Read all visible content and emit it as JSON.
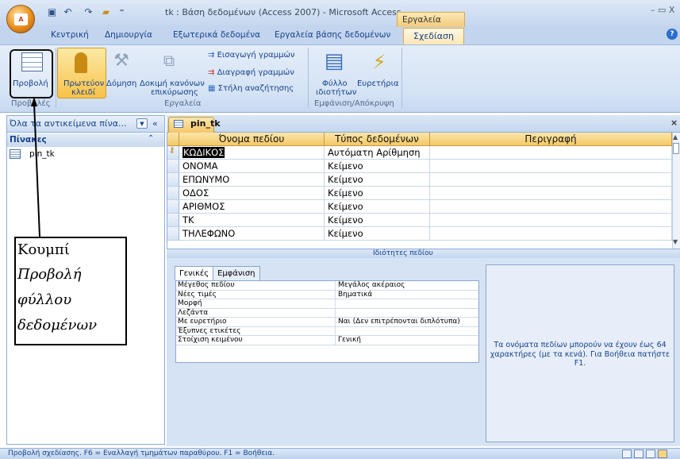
{
  "window": {
    "title": "tk : Βάση δεδομένων (Access 2007) - Microsoft Access",
    "contextual_tab_group": "Εργαλεία πίνακα",
    "controls": "– ▭ X"
  },
  "qat": {
    "save_icon": "save-icon",
    "undo_icon": "undo-icon",
    "redo_icon": "redo-icon",
    "open_icon": "folder-icon"
  },
  "office_button": {
    "icon": "office-logo-icon"
  },
  "menu_tabs": [
    "Κεντρική",
    "Δημιουργία",
    "Εξωτερικά δεδομένα",
    "Εργαλεία βάσης δεδομένων",
    "Σχεδίαση"
  ],
  "ribbon": {
    "groups": {
      "views": "Προβολές",
      "tools": "Εργαλεία",
      "show_hide": "Εμφάνιση/Απόκρυψη"
    },
    "buttons": {
      "view": "Προβολή",
      "primary_key_1": "Πρωτεύον",
      "primary_key_2": "κλειδί",
      "builder": "Δόμηση",
      "test_rules_1": "Δοκιμή κανόνων",
      "test_rules_2": "επικύρωσης",
      "insert_rows": "Εισαγωγή γραμμών",
      "delete_rows": "Διαγραφή γραμμών",
      "lookup_column": "Στήλη αναζήτησης",
      "property_sheet_1": "Φύλλο",
      "property_sheet_2": "ιδιοτήτων",
      "indexes": "Ευρετήρια"
    }
  },
  "nav_pane": {
    "title": "Όλα τα αντικείμενα πίνα...",
    "collapse": "«",
    "group": "Πίνακες",
    "group_chevron": "⌃",
    "items": [
      "pin_tk"
    ]
  },
  "document": {
    "tab": "pin_tk",
    "close": "×",
    "columns": [
      "Όνομα πεδίου",
      "Τύπος δεδομένων",
      "Περιγραφή"
    ],
    "rows": [
      {
        "name": "ΚΩΔΙΚΟΣ",
        "type": "Αυτόματη Αρίθμηση",
        "desc": ""
      },
      {
        "name": "ΟΝΟΜΑ",
        "type": "Κείμενο",
        "desc": ""
      },
      {
        "name": "ΕΠΩΝΥΜΟ",
        "type": "Κείμενο",
        "desc": ""
      },
      {
        "name": "ΟΔΟΣ",
        "type": "Κείμενο",
        "desc": ""
      },
      {
        "name": "ΑΡΙΘΜΟΣ",
        "type": "Κείμενο",
        "desc": ""
      },
      {
        "name": "ΤΚ",
        "type": "Κείμενο",
        "desc": ""
      },
      {
        "name": "ΤΗΛΕΦΩΝΟ",
        "type": "Κείμενο",
        "desc": ""
      }
    ]
  },
  "properties": {
    "title": "Ιδιότητες πεδίου",
    "tabs": [
      "Γενικές",
      "Εμφάνιση"
    ],
    "rows": [
      {
        "label": "Μέγεθος πεδίου",
        "value": "Μεγάλος ακέραιος"
      },
      {
        "label": "Νέες τιμές",
        "value": "Βηματικά"
      },
      {
        "label": "Μορφή",
        "value": ""
      },
      {
        "label": "Λεζάντα",
        "value": ""
      },
      {
        "label": "Με ευρετήριο",
        "value": "Ναι (Δεν επιτρέπονται διπλότυπα)"
      },
      {
        "label": "Έξυπνες ετικέτες",
        "value": ""
      },
      {
        "label": "Στοίχιση κειμένου",
        "value": "Γενική"
      }
    ],
    "help": "Τα ονόματα πεδίων μπορούν να έχουν έως 64 χαρακτήρες (με τα κενά). Για Βοήθεια πατήστε F1."
  },
  "status": {
    "text": "Προβολή σχεδίασης. F6 = Εναλλαγή τμημάτων παραθύρου.  F1 = Βοήθεια."
  },
  "callout": {
    "line1": "Κουμπί",
    "line2": "Προβολή",
    "line3": "φύλλου",
    "line4": "δεδομένων"
  }
}
